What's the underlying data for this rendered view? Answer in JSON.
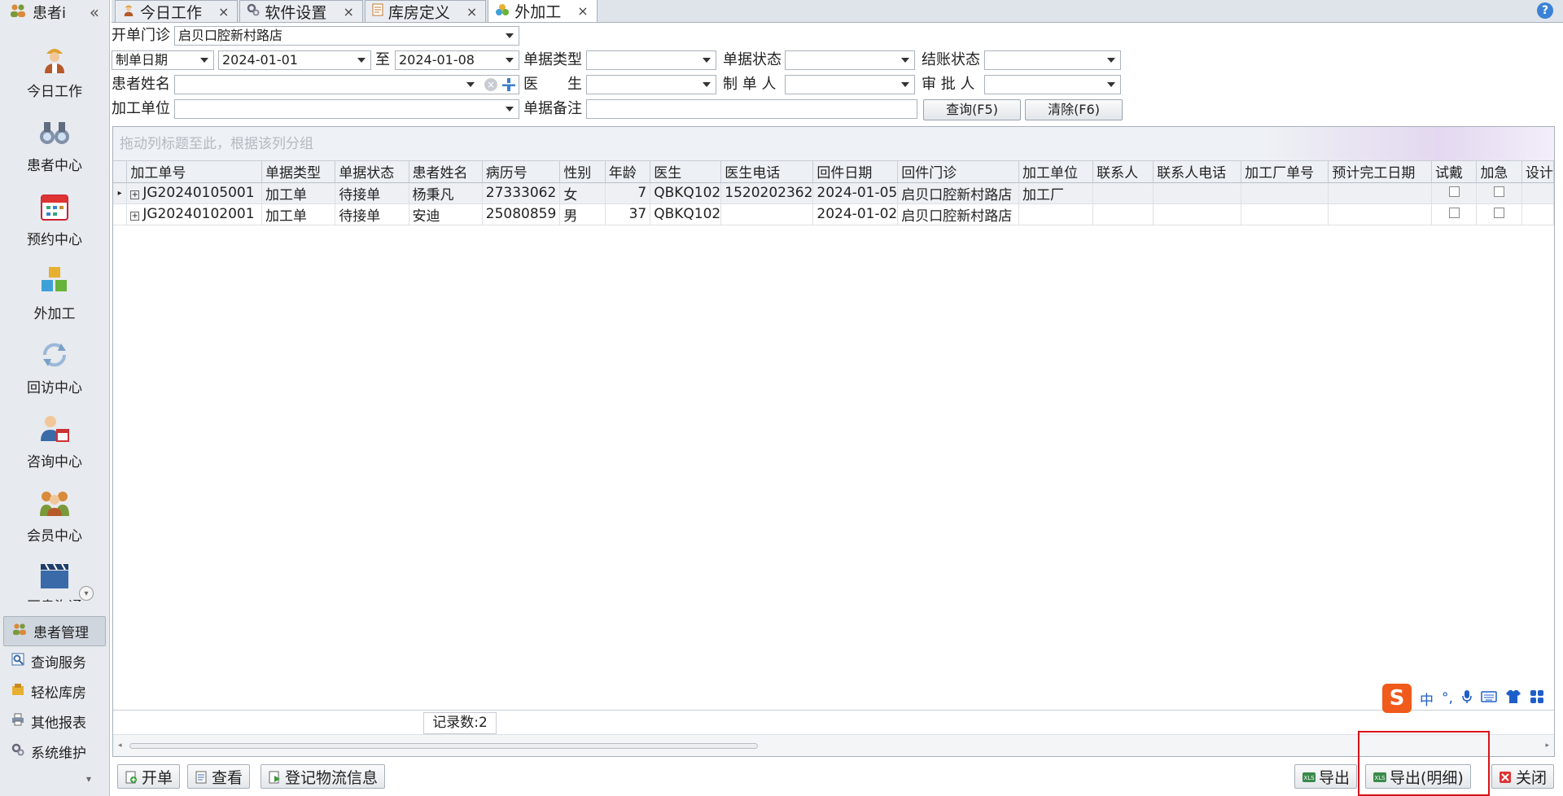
{
  "sidebar": {
    "title": "患者i",
    "collapse": "«",
    "big_items": [
      {
        "label": "今日工作",
        "icon": "worker-icon"
      },
      {
        "label": "患者中心",
        "icon": "binoculars-icon"
      },
      {
        "label": "预约中心",
        "icon": "calendar-icon"
      },
      {
        "label": "外加工",
        "icon": "boxes-icon"
      },
      {
        "label": "回访中心",
        "icon": "refresh-icon"
      },
      {
        "label": "咨询中心",
        "icon": "consultant-icon"
      },
      {
        "label": "会员中心",
        "icon": "members-icon"
      },
      {
        "label": "医患沟通",
        "icon": "clapper-icon"
      }
    ],
    "groups": [
      {
        "label": "患者管理",
        "active": true
      },
      {
        "label": "查询服务"
      },
      {
        "label": "轻松库房"
      },
      {
        "label": "其他报表"
      },
      {
        "label": "系统维护"
      }
    ],
    "foot": "▾"
  },
  "tabs": [
    {
      "label": "今日工作",
      "close": "×"
    },
    {
      "label": "软件设置",
      "close": "×"
    },
    {
      "label": "库房定义",
      "close": "×"
    },
    {
      "label": "外加工",
      "close": "×",
      "active": true
    }
  ],
  "help": "?",
  "filter": {
    "clinic_label": "开单门诊",
    "clinic_value": "启贝口腔新村路店",
    "date_type": "制单日期",
    "date_from": "2024-01-01",
    "to": "至",
    "date_to": "2024-01-08",
    "doc_type_label": "单据类型",
    "doc_type_value": "",
    "doc_status_label": "单据状态",
    "doc_status_value": "",
    "settle_label": "结账状态",
    "settle_value": "",
    "patient_label": "患者姓名",
    "patient_value": "",
    "doctor_label": "医　　生",
    "doctor_value": "",
    "maker_label": "制 单 人",
    "maker_value": "",
    "approver_label": "审 批 人",
    "approver_value": "",
    "unit_label": "加工单位",
    "unit_value": "",
    "remark_label": "单据备注",
    "remark_value": "",
    "query_btn": "查询(F5)",
    "clear_btn": "清除(F6)"
  },
  "grid": {
    "group_hint": "拖动列标题至此，根据该列分组",
    "columns": [
      "加工单号",
      "单据类型",
      "单据状态",
      "患者姓名",
      "病历号",
      "性别",
      "年龄",
      "医生",
      "医生电话",
      "回件日期",
      "回件门诊",
      "加工单位",
      "联系人",
      "联系人电话",
      "加工厂单号",
      "预计完工日期",
      "试戴",
      "加急",
      "设计"
    ],
    "rows": [
      {
        "id": "JG20240105001",
        "type": "加工单",
        "status": "待接单",
        "name": "杨秉凡",
        "record": "27333062",
        "sex": "女",
        "age": "7",
        "doctor": "QBKQ102",
        "phone": "1520202362",
        "ret_date": "2024-01-05",
        "ret_clinic": "启贝口腔新村路店",
        "unit": "加工厂",
        "contact": "",
        "contact_phone": "",
        "factory_no": "",
        "eta": ""
      },
      {
        "id": "JG20240102001",
        "type": "加工单",
        "status": "待接单",
        "name": "安迪",
        "record": "25080859",
        "sex": "男",
        "age": "37",
        "doctor": "QBKQ102",
        "phone": "",
        "ret_date": "2024-01-02",
        "ret_clinic": "启贝口腔新村路店",
        "unit": "",
        "contact": "",
        "contact_phone": "",
        "factory_no": "",
        "eta": ""
      }
    ],
    "count_label": "记录数:2"
  },
  "toolbar": {
    "open": "开单",
    "view": "查看",
    "logistics": "登记物流信息",
    "export": "导出",
    "export_detail": "导出(明细)",
    "close": "关闭"
  },
  "ime": {
    "logo": "S",
    "lang": "中",
    "punct": "°,"
  },
  "colors": {
    "accent": "#3b82d6",
    "highlight": "#d8121a",
    "ime": "#f05a1a"
  }
}
